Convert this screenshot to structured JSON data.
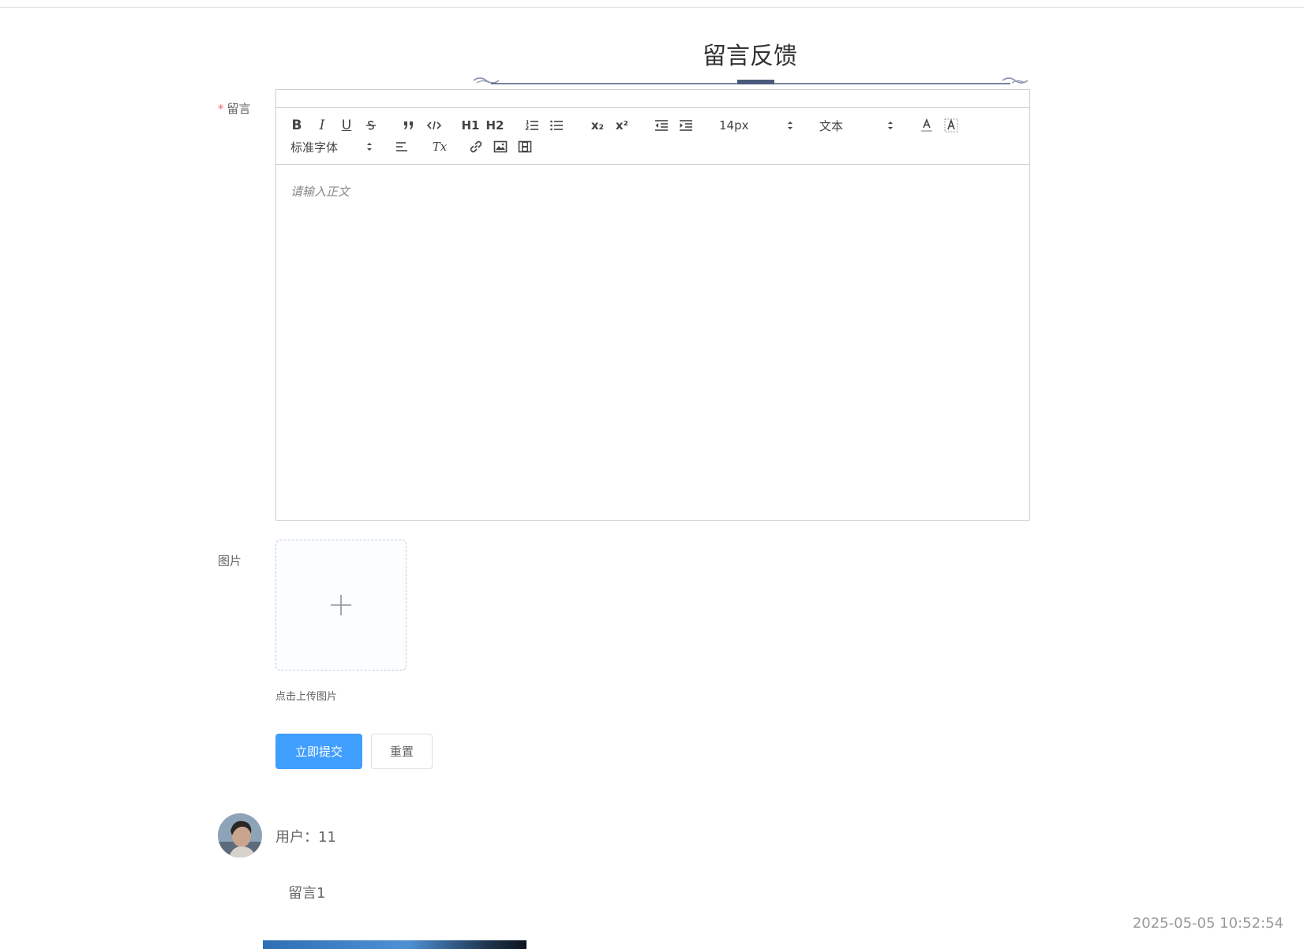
{
  "page": {
    "title": "留言反馈"
  },
  "form": {
    "message_label": "留言",
    "required_mark": "*",
    "image_label": "图片",
    "upload_tip": "点击上传图片",
    "submit_label": "立即提交",
    "reset_label": "重置"
  },
  "editor": {
    "placeholder": "请输入正文",
    "size_picker": "14px",
    "header_picker": "文本",
    "font_picker": "标准字体",
    "tools": {
      "bold": "B",
      "italic": "I",
      "underline": "U",
      "h1": "H1",
      "h2": "H2",
      "subscript": "x₂",
      "superscript": "x²",
      "clean": "Tx"
    }
  },
  "comments": [
    {
      "user": "用户：11",
      "text": "留言1",
      "time": "2025-05-05 10:52:54"
    }
  ],
  "colors": {
    "primary": "#409eff",
    "required": "#f56c6c",
    "accent": "#4a5a7c"
  }
}
